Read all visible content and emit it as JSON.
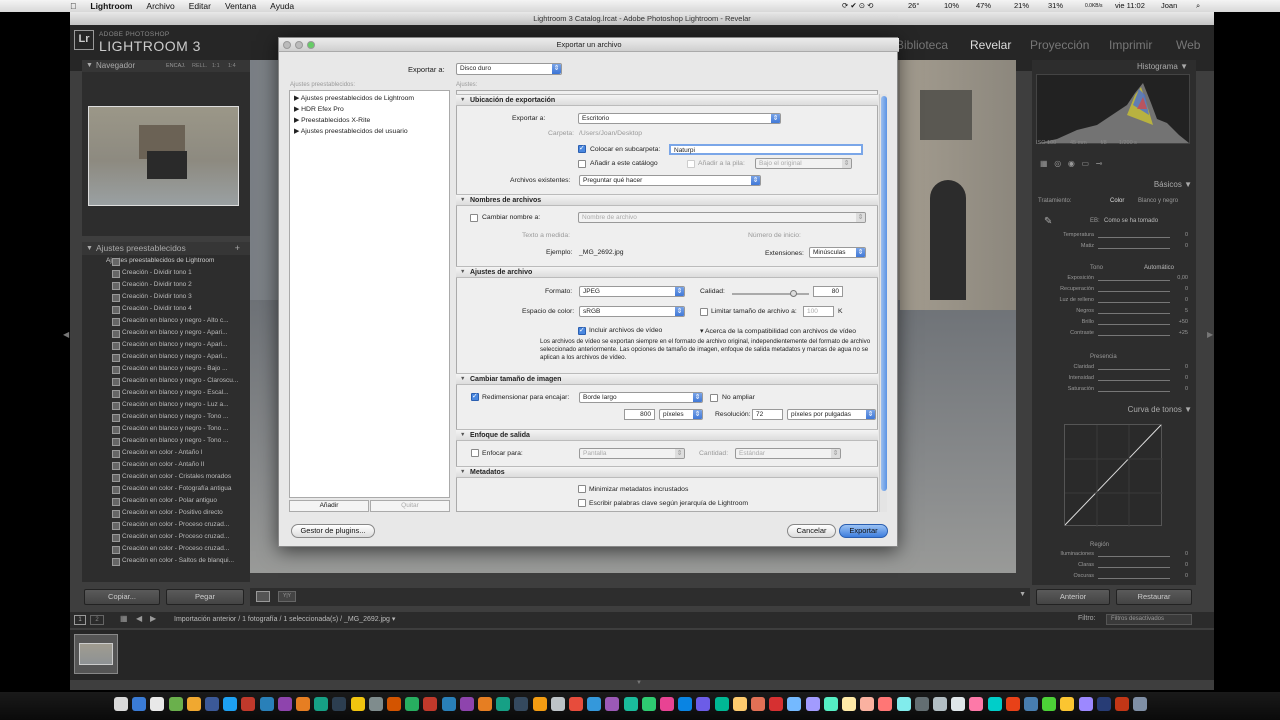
{
  "menubar": {
    "app": "Lightroom",
    "menus": [
      "Archivo",
      "Editar",
      "Ventana",
      "Ayuda"
    ],
    "status": {
      "temp": "26°",
      "pct1": "10%",
      "pct2": "47%",
      "pct3": "21%",
      "battery": "31%",
      "net": "0.0KB/s",
      "clock": "vie 11:02",
      "user": "Joan"
    }
  },
  "window": {
    "title": "Lightroom 3 Catalog.lrcat - Adobe Photoshop Lightroom - Revelar"
  },
  "identity": {
    "logo": "Lr",
    "adobe": "ADOBE PHOTOSHOP",
    "product": "LIGHTROOM 3"
  },
  "modules": [
    "Biblioteca",
    "Revelar",
    "Proyección",
    "Imprimir",
    "Web"
  ],
  "navigator": {
    "title": "Navegador",
    "zoom": [
      "ENCAJ.",
      "RELL.",
      "1:1",
      "1:4"
    ]
  },
  "presets_panel": {
    "title": "Ajustes preestablecidos",
    "group": "Ajustes preestablecidos de Lightroom",
    "items": [
      "Creación - Dividir tono 1",
      "Creación - Dividir tono 2",
      "Creación - Dividir tono 3",
      "Creación - Dividir tono 4",
      "Creación en blanco y negro - Alto c...",
      "Creación en blanco y negro - Apari...",
      "Creación en blanco y negro - Apari...",
      "Creación en blanco y negro - Apari...",
      "Creación en blanco y negro - Bajo ...",
      "Creación en blanco y negro - Claroscu...",
      "Creación en blanco y negro - Escal...",
      "Creación en blanco y negro - Luz a...",
      "Creación en blanco y negro - Tono ...",
      "Creación en blanco y negro - Tono ...",
      "Creación en blanco y negro - Tono ...",
      "Creación en color - Antaño I",
      "Creación en color - Antaño II",
      "Creación en color - Cristales morados",
      "Creación en color - Fotografía antigua",
      "Creación en color - Polar antiguo",
      "Creación en color - Positivo directo",
      "Creación en color - Proceso cruzad...",
      "Creación en color - Proceso cruzad...",
      "Creación en color - Proceso cruzad...",
      "Creación en color - Saltos de blanqui..."
    ],
    "copy": "Copiar...",
    "paste": "Pegar"
  },
  "right_panel": {
    "histogram": "Histograma",
    "hist_info": [
      "ISO 100",
      "45 mm",
      "f/8",
      "1/200 s"
    ],
    "basic": "Básicos",
    "treatment": "Tratamiento:",
    "color": "Color",
    "bw": "Blanco y negro",
    "wb_label": "EB:",
    "wb_value": "Como se ha tomado",
    "tone": "Tono",
    "auto": "Automático",
    "presence": "Presencia",
    "tone_curve": "Curva de tonos",
    "region": "Región",
    "previous": "Anterior",
    "reset": "Restaurar",
    "sliders_wb": [
      {
        "label": "Temperatura",
        "value": "0"
      },
      {
        "label": "Matiz",
        "value": "0"
      }
    ],
    "sliders_tone": [
      {
        "label": "Exposición",
        "value": "0,00"
      },
      {
        "label": "Recuperación",
        "value": "0"
      },
      {
        "label": "Luz de relleno",
        "value": "0"
      },
      {
        "label": "Negros",
        "value": "5"
      },
      {
        "label": "Brillo",
        "value": "+50"
      },
      {
        "label": "Contraste",
        "value": "+25"
      }
    ],
    "sliders_presence": [
      {
        "label": "Claridad",
        "value": "0"
      },
      {
        "label": "Intensidad",
        "value": "0"
      },
      {
        "label": "Saturación",
        "value": "0"
      }
    ],
    "sliders_region": [
      {
        "label": "Iluminaciones",
        "value": "0"
      },
      {
        "label": "Claras",
        "value": "0"
      },
      {
        "label": "Oscuras",
        "value": "0"
      }
    ]
  },
  "filmstrip": {
    "path": "Importación anterior / 1 fotografía / 1 seleccionada(s) / _MG_2692.jpg",
    "filter_label": "Filtro:",
    "filter_value": "Filtros desactivados"
  },
  "dialog": {
    "title": "Exportar un archivo",
    "export_to_label": "Exportar a:",
    "export_to_value": "Disco duro",
    "presets_label": "Ajustes preestablecidos:",
    "settings_label": "Ajustes:",
    "preset_groups": [
      "Ajustes preestablecidos de Lightroom",
      "HDR Efex Pro",
      "Preestablecidos X-Rite",
      "Ajustes preestablecidos del usuario"
    ],
    "add": "Añadir",
    "remove": "Quitar",
    "plugin_manager": "Gestor de plugins...",
    "cancel": "Cancelar",
    "export": "Exportar",
    "location": {
      "title": "Ubicación de exportación",
      "export_to_label": "Exportar a:",
      "export_to_value": "Escritorio",
      "folder_label": "Carpeta:",
      "folder_value": "/Users/Joan/Desktop",
      "subfolder_label": "Colocar en subcarpeta:",
      "subfolder_value": "Naturpi",
      "add_catalog": "Añadir a este catálogo",
      "add_stack": "Añadir a la pila:",
      "stack_value": "Bajo el original",
      "existing_label": "Archivos existentes:",
      "existing_value": "Preguntar qué hacer"
    },
    "naming": {
      "title": "Nombres de archivos",
      "rename_label": "Cambiar nombre a:",
      "rename_value": "Nombre de archivo",
      "custom_text": "Texto a medida:",
      "start_number": "Número de inicio:",
      "example_label": "Ejemplo:",
      "example_value": "_MG_2692.jpg",
      "ext_label": "Extensiones:",
      "ext_value": "Minúsculas"
    },
    "file_settings": {
      "title": "Ajustes de archivo",
      "format_label": "Formato:",
      "format_value": "JPEG",
      "quality_label": "Calidad:",
      "quality_value": "80",
      "quality_fraction": 0.8,
      "colorspace_label": "Espacio de color:",
      "colorspace_value": "sRGB",
      "limit_label": "Limitar tamaño de archivo a:",
      "limit_value": "100",
      "limit_unit": "K",
      "include_video": "Incluir archivos de vídeo",
      "video_compat": "Acerca de la compatibilidad con archivos de vídeo",
      "video_note": "Los archivos de vídeo se exportan siempre en el formato de archivo original, independientemente del formato de archivo seleccionado anteriormente. Las opciones de tamaño de imagen, enfoque de salida metadatos y marcas de agua no se aplican a los archivos de vídeo."
    },
    "resize": {
      "title": "Cambiar tamaño de imagen",
      "fit_label": "Redimensionar para encajar:",
      "fit_value": "Borde largo",
      "no_enlarge": "No ampliar",
      "size_value": "800",
      "size_unit": "píxeles",
      "res_label": "Resolución:",
      "res_value": "72",
      "res_unit": "píxeles por pulgadas"
    },
    "sharpen": {
      "title": "Enfoque de salida",
      "for_label": "Enfocar para:",
      "for_value": "Pantalla",
      "amount_label": "Cantidad:",
      "amount_value": "Estándar"
    },
    "metadata": {
      "title": "Metadatos",
      "minimize": "Minimizar metadatos incrustados",
      "keywords": "Escribir palabras clave según jerarquía de Lightroom"
    }
  }
}
